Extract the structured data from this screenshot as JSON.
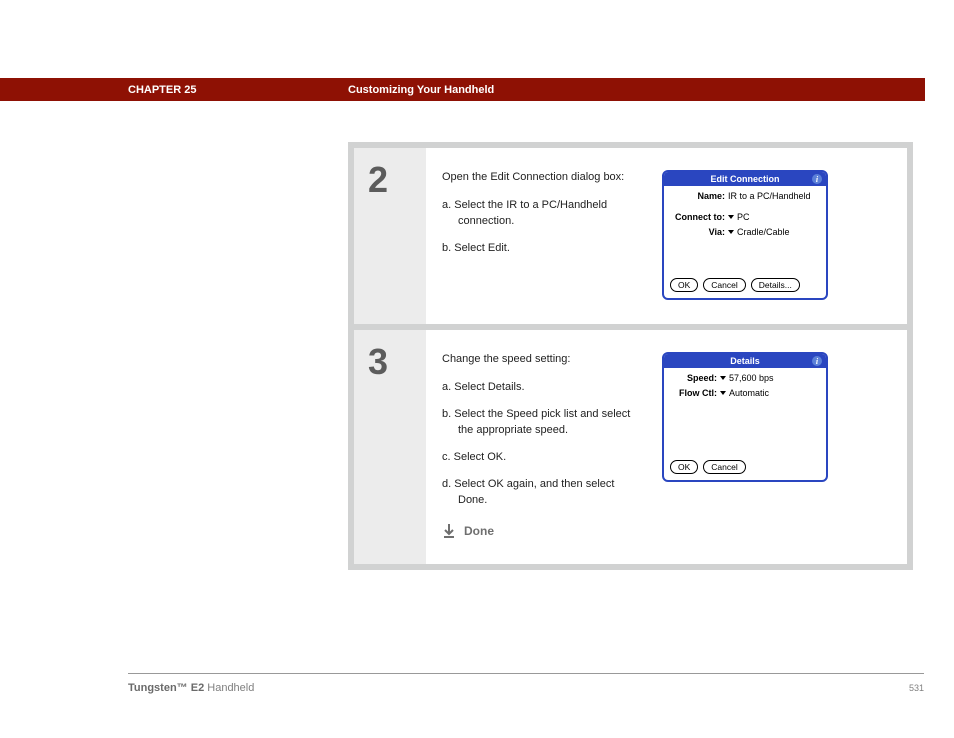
{
  "header": {
    "chapter": "CHAPTER 25",
    "title": "Customizing Your Handheld"
  },
  "steps": [
    {
      "num": "2",
      "intro": "Open the Edit Connection dialog box:",
      "subs": [
        "a.  Select the IR to a PC/Handheld connection.",
        "b.  Select Edit."
      ],
      "dialog": {
        "title": "Edit Connection",
        "rows": [
          {
            "label": "Name:",
            "value": "IR to a PC/Handheld",
            "dropdown": false
          },
          {
            "label": "Connect to:",
            "value": "PC",
            "dropdown": true
          },
          {
            "label": "Via:",
            "value": "Cradle/Cable",
            "dropdown": true
          }
        ],
        "buttons": [
          "OK",
          "Cancel",
          "Details..."
        ]
      }
    },
    {
      "num": "3",
      "intro": "Change the speed setting:",
      "subs": [
        "a.  Select Details.",
        "b.  Select the Speed pick list and select the appropriate speed.",
        "c.  Select OK.",
        "d.  Select OK again, and then select Done."
      ],
      "done": "Done",
      "dialog": {
        "title": "Details",
        "rows": [
          {
            "label": "Speed:",
            "value": "57,600 bps",
            "dropdown": true
          },
          {
            "label": "Flow Ctl:",
            "value": "Automatic",
            "dropdown": true
          }
        ],
        "buttons": [
          "OK",
          "Cancel"
        ]
      }
    }
  ],
  "footer": {
    "product_bold": "Tungsten™ E2",
    "product_rest": " Handheld",
    "page": "531"
  }
}
